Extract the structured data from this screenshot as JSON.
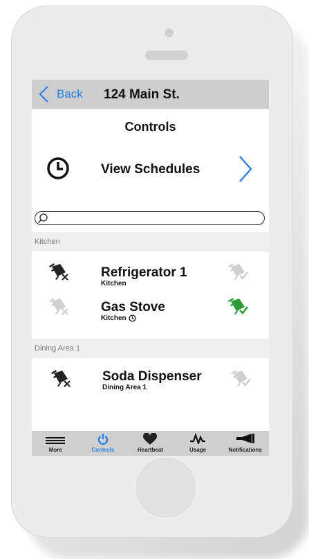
{
  "nav": {
    "back_label": "Back",
    "title": "124 Main St."
  },
  "page": {
    "title": "Controls",
    "schedule_label": "View Schedules"
  },
  "search": {
    "placeholder": "",
    "value": ""
  },
  "sections": [
    {
      "header": "Kitchen",
      "devices": [
        {
          "name": "Refrigerator 1",
          "location": "Kitchen",
          "state_on": false,
          "scheduled": false
        },
        {
          "name": "Gas Stove",
          "location": "Kitchen",
          "state_on": true,
          "scheduled": true
        }
      ]
    },
    {
      "header": "Dining Area 1",
      "devices": [
        {
          "name": "Soda Dispenser",
          "location": "Dining Area 1",
          "state_on": false,
          "scheduled": false
        }
      ]
    }
  ],
  "tabs": [
    {
      "label": "More",
      "icon": "hamburger-icon",
      "active": false
    },
    {
      "label": "Controls",
      "icon": "power-icon",
      "active": true
    },
    {
      "label": "Heartbeat",
      "icon": "heart-icon",
      "active": false
    },
    {
      "label": "Usage",
      "icon": "pulse-icon",
      "active": false
    },
    {
      "label": "Notifications",
      "icon": "megaphone-icon",
      "active": false
    }
  ],
  "colors": {
    "accent": "#2a82e4",
    "plug_on": "#2e9b3a",
    "plug_dark": "#222222",
    "plug_dim": "#cfcfcf"
  }
}
